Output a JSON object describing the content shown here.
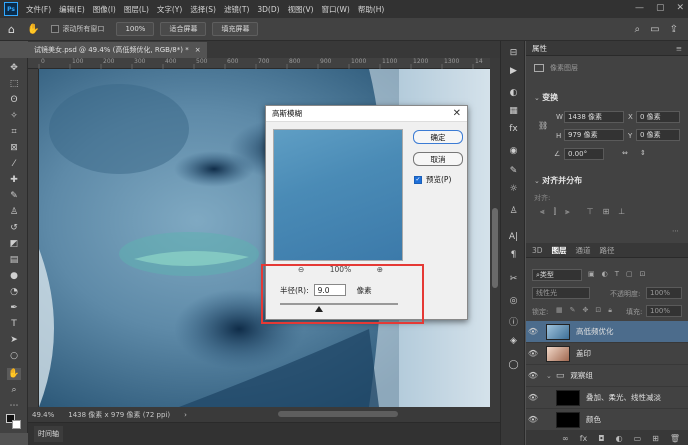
{
  "app": {
    "logo": "Ps"
  },
  "menu": {
    "items": [
      "文件(F)",
      "编辑(E)",
      "图像(I)",
      "图层(L)",
      "文字(Y)",
      "选择(S)",
      "滤镜(T)",
      "3D(D)",
      "视图(V)",
      "窗口(W)",
      "帮助(H)"
    ]
  },
  "window_controls": {
    "minimize": "—",
    "maximize": "▢",
    "close": "✕"
  },
  "options_bar": {
    "scroll_all_label": "滚动所有窗口",
    "zoom_value": "100%",
    "fit_screen": "适合屏幕",
    "fill_screen": "填充屏幕"
  },
  "document": {
    "tab_title": "试镜美女.psd @ 49.4% (高低频优化, RGB/8*) *",
    "tab_close": "×",
    "zoom": "49.4%",
    "size": "1438 像素 x 979 像素 (72 ppi)"
  },
  "ruler": {
    "ticks": [
      "0",
      "100",
      "200",
      "300",
      "400",
      "500",
      "600",
      "700",
      "800",
      "900",
      "1000",
      "1100",
      "1200",
      "1300",
      "14"
    ]
  },
  "timeline": {
    "label": "时间轴"
  },
  "properties": {
    "tab": "属性",
    "layer_type": "像素图层",
    "transform_title": "变换",
    "w_label": "W",
    "w_value": "1438 像素",
    "h_label": "H",
    "h_value": "979 像素",
    "x_label": "X",
    "x_value": "0 像素",
    "y_label": "Y",
    "y_value": "0 像素",
    "angle_value": "0.00°",
    "align_title": "对齐并分布",
    "align_label": "对齐:"
  },
  "layers_panel": {
    "tabs": [
      "3D",
      "图层",
      "通道",
      "路径"
    ],
    "filter_kind": "类型",
    "blend_mode": "线性光",
    "opacity_label": "不透明度:",
    "opacity_value": "100%",
    "lock_label": "锁定:",
    "fill_label": "填充:",
    "fill_value": "100%",
    "layers": [
      {
        "name": "高低频优化",
        "selected": true
      },
      {
        "name": "盖印",
        "selected": false
      },
      {
        "name": "观察组",
        "selected": false,
        "group": true
      },
      {
        "name": "叠加、柔光、线性减淡",
        "selected": false
      },
      {
        "name": "颜色",
        "selected": false
      }
    ]
  },
  "dialog": {
    "title": "高斯模糊",
    "close": "✕",
    "ok": "确定",
    "cancel": "取消",
    "preview": "预览(P)",
    "zoom_out": "⊖",
    "zoom_level": "100%",
    "zoom_in": "⊕",
    "radius_label": "半径(R):",
    "radius_value": "9.0",
    "radius_unit": "像素",
    "radius_slider_fraction": 0.33
  },
  "colors": {
    "accent": "#31a8ff",
    "highlight_box": "#e53935",
    "selected_layer": "#4c6c8c"
  }
}
